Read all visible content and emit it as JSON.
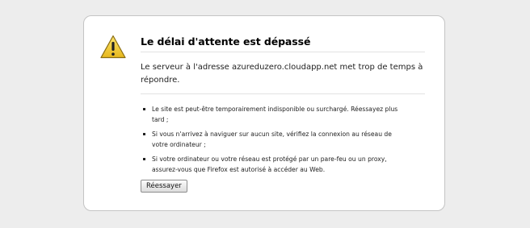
{
  "error": {
    "title": "Le délai d'attente est dépassé",
    "short_desc": "Le serveur à l'adresse azureduzero.cloudapp.net met trop de temps à répondre.",
    "items": [
      "Le site est peut-être temporairement indisponible ou surchargé. Réessayez plus tard ;",
      "Si vous n'arrivez à naviguer sur aucun site, vérifiez la connexion au réseau de votre ordinateur ;",
      "Si votre ordinateur ou votre réseau est protégé par un pare-feu ou un proxy, assurez-vous que Firefox est autorisé à accéder au Web."
    ],
    "retry_label": "Réessayer",
    "icon": "warning-icon"
  }
}
